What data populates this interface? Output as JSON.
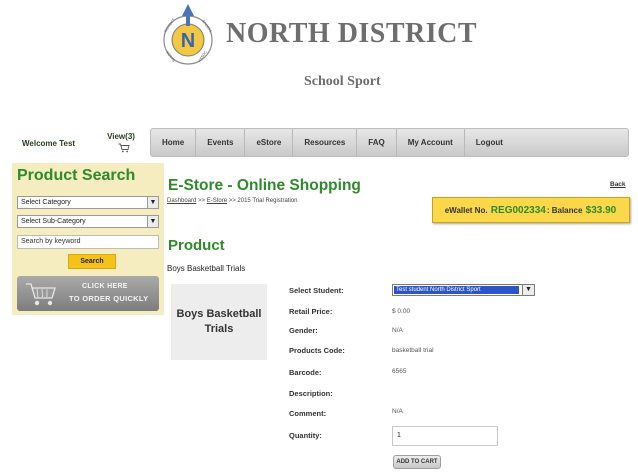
{
  "header": {
    "title": "NORTH DISTRICT",
    "subtitle": "School Sport",
    "emblem_letter": "N",
    "emblem_ring_words": [
      "DISTRICT",
      "SPORTS",
      "NORTH",
      "ASSOC"
    ]
  },
  "topbar": {
    "welcome": "Welcome Test",
    "cart_label": "View(3)"
  },
  "nav": {
    "items": [
      {
        "label": "Home"
      },
      {
        "label": "Events"
      },
      {
        "label": "eStore"
      },
      {
        "label": "Resources"
      },
      {
        "label": "FAQ"
      },
      {
        "label": "My Account"
      },
      {
        "label": "Logout"
      }
    ]
  },
  "sidebar": {
    "title": "Product Search",
    "category_value": "Select Category",
    "subcategory_value": "Select Sub-Category",
    "keyword_placeholder": "Search by keyword",
    "search_label": "Search",
    "order_line1": "CLICK HERE",
    "order_line2": "TO ORDER QUICKLY"
  },
  "main": {
    "title": "E-Store - Online Shopping",
    "back": "Back",
    "breadcrumb": {
      "dashboard": "Dashboard",
      "sep1": ">>",
      "estore": "E-Store",
      "sep2": ">>",
      "current": "2015 Trial Registration"
    },
    "wallet": {
      "prefix": "eWallet No.",
      "number": "REG002334",
      "balance_label": ": Balance",
      "balance": "$33.90"
    }
  },
  "product": {
    "heading": "Product",
    "name": "Boys Basketball Trials",
    "image_line1": "Boys Basketball",
    "image_line2": "Trials",
    "fields": {
      "select_student_label": "Select Student:",
      "select_student_value": "Test student North District Sport",
      "retail_price_label": "Retail Price:",
      "retail_price_value": "$ 0.00",
      "gender_label": "Gender:",
      "gender_value": "N/A",
      "code_label": "Products Code:",
      "code_value": "basketball trial",
      "barcode_label": "Barcode:",
      "barcode_value": "6565",
      "description_label": "Description:",
      "comment_label": "Comment:",
      "comment_value": "N/A",
      "quantity_label": "Quantity:",
      "quantity_value": "1"
    },
    "add_to_cart": "ADD TO CART"
  },
  "colors": {
    "brand_green": "#2f8a2a",
    "sidebar_bg": "#f5ecc0",
    "wallet_bg": "#fbd84a",
    "search_button": "#f3c31a",
    "title_gray": "#6e6e6e"
  },
  "icons": [
    "north-district-logo-icon",
    "shopping-cart-icon",
    "order-cart-icon",
    "dropdown-arrow-icon"
  ]
}
